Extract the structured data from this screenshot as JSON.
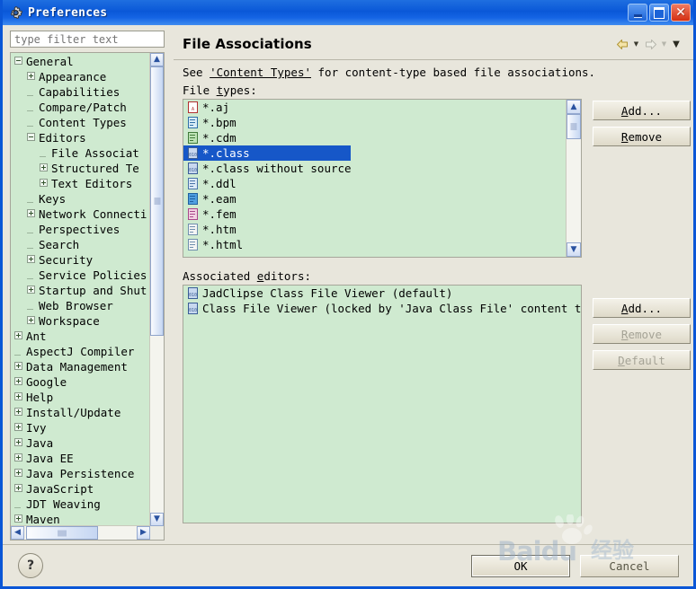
{
  "window": {
    "title": "Preferences",
    "icon": "gear-icon",
    "buttons": {
      "minimize": "minimize-icon",
      "maximize": "maximize-icon",
      "close": "close-icon"
    }
  },
  "filter": {
    "placeholder": "type filter text",
    "value": ""
  },
  "tree": {
    "items": [
      {
        "label": "General",
        "indent": 0,
        "toggle": "minus",
        "selected": false
      },
      {
        "label": "Appearance",
        "indent": 1,
        "toggle": "plus",
        "selected": false
      },
      {
        "label": "Capabilities",
        "indent": 1,
        "toggle": "none",
        "selected": false
      },
      {
        "label": "Compare/Patch",
        "indent": 1,
        "toggle": "none",
        "selected": false
      },
      {
        "label": "Content Types",
        "indent": 1,
        "toggle": "none",
        "selected": false
      },
      {
        "label": "Editors",
        "indent": 1,
        "toggle": "minus",
        "selected": false
      },
      {
        "label": "File Associat",
        "indent": 2,
        "toggle": "none",
        "selected": false
      },
      {
        "label": "Structured Te",
        "indent": 2,
        "toggle": "plus",
        "selected": false
      },
      {
        "label": "Text Editors",
        "indent": 2,
        "toggle": "plus",
        "selected": false
      },
      {
        "label": "Keys",
        "indent": 1,
        "toggle": "none",
        "selected": false
      },
      {
        "label": "Network Connecti",
        "indent": 1,
        "toggle": "plus",
        "selected": false
      },
      {
        "label": "Perspectives",
        "indent": 1,
        "toggle": "none",
        "selected": false
      },
      {
        "label": "Search",
        "indent": 1,
        "toggle": "none",
        "selected": false
      },
      {
        "label": "Security",
        "indent": 1,
        "toggle": "plus",
        "selected": false
      },
      {
        "label": "Service Policies",
        "indent": 1,
        "toggle": "none",
        "selected": false
      },
      {
        "label": "Startup and Shut",
        "indent": 1,
        "toggle": "plus",
        "selected": false
      },
      {
        "label": "Web Browser",
        "indent": 1,
        "toggle": "none",
        "selected": false
      },
      {
        "label": "Workspace",
        "indent": 1,
        "toggle": "plus",
        "selected": false
      },
      {
        "label": "Ant",
        "indent": 0,
        "toggle": "plus",
        "selected": false
      },
      {
        "label": "AspectJ Compiler",
        "indent": 0,
        "toggle": "none",
        "selected": false
      },
      {
        "label": "Data Management",
        "indent": 0,
        "toggle": "plus",
        "selected": false
      },
      {
        "label": "Google",
        "indent": 0,
        "toggle": "plus",
        "selected": false
      },
      {
        "label": "Help",
        "indent": 0,
        "toggle": "plus",
        "selected": false
      },
      {
        "label": "Install/Update",
        "indent": 0,
        "toggle": "plus",
        "selected": false
      },
      {
        "label": "Ivy",
        "indent": 0,
        "toggle": "plus",
        "selected": false
      },
      {
        "label": "Java",
        "indent": 0,
        "toggle": "plus",
        "selected": false
      },
      {
        "label": "Java EE",
        "indent": 0,
        "toggle": "plus",
        "selected": false
      },
      {
        "label": "Java Persistence",
        "indent": 0,
        "toggle": "plus",
        "selected": false
      },
      {
        "label": "JavaScript",
        "indent": 0,
        "toggle": "plus",
        "selected": false
      },
      {
        "label": "JDT Weaving",
        "indent": 0,
        "toggle": "none",
        "selected": false
      },
      {
        "label": "Maven",
        "indent": 0,
        "toggle": "plus",
        "selected": false
      }
    ]
  },
  "page": {
    "title": "File Associations",
    "nav": {
      "back_icon": "back-arrow-icon",
      "back_menu_icon": "chevron-down-icon",
      "forward_icon": "forward-arrow-icon",
      "forward_menu_icon": "chevron-down-icon",
      "menu_icon": "chevron-down-icon"
    },
    "description_prefix": "See ",
    "description_link": "'Content Types'",
    "description_suffix": " for content-type based file associations.",
    "file_types_label_pre": "File ",
    "file_types_label_mnemonic": "t",
    "file_types_label_post": "ypes:",
    "associated_editors_label_pre": "Associated ",
    "associated_editors_label_mnemonic": "e",
    "associated_editors_label_post": "ditors:"
  },
  "file_types": {
    "rows": [
      {
        "label": "*.aj",
        "icon": "aspectj-file-icon",
        "selected": false
      },
      {
        "label": "*.bpm",
        "icon": "bpm-file-icon",
        "selected": false
      },
      {
        "label": "*.cdm",
        "icon": "cdm-file-icon",
        "selected": false
      },
      {
        "label": "*.class",
        "icon": "class-file-icon",
        "selected": true
      },
      {
        "label": "*.class without source",
        "icon": "class-file-icon",
        "selected": false
      },
      {
        "label": "*.ddl",
        "icon": "ddl-file-icon",
        "selected": false
      },
      {
        "label": "*.eam",
        "icon": "eam-file-icon",
        "selected": false
      },
      {
        "label": "*.fem",
        "icon": "fem-file-icon",
        "selected": false
      },
      {
        "label": "*.htm",
        "icon": "html-file-icon",
        "selected": false
      },
      {
        "label": "*.html",
        "icon": "html-file-icon",
        "selected": false
      }
    ],
    "buttons": [
      {
        "label_pre": "",
        "mnemonic": "A",
        "label_post": "dd...",
        "enabled": true,
        "name": "file-types-add-button"
      },
      {
        "label_pre": "",
        "mnemonic": "R",
        "label_post": "emove",
        "enabled": true,
        "name": "file-types-remove-button"
      }
    ]
  },
  "associated_editors": {
    "rows": [
      {
        "label": "JadClipse Class File Viewer (default)",
        "icon": "class-file-icon"
      },
      {
        "label": "Class File Viewer (locked by 'Java Class File' content type)",
        "icon": "class-file-icon"
      }
    ],
    "buttons": [
      {
        "label_pre": "",
        "mnemonic": "A",
        "label_post": "dd...",
        "enabled": true,
        "name": "editors-add-button"
      },
      {
        "label_pre": "",
        "mnemonic": "R",
        "label_post": "emove",
        "enabled": false,
        "name": "editors-remove-button"
      },
      {
        "label_pre": "",
        "mnemonic": "D",
        "label_post": "efault",
        "enabled": false,
        "name": "editors-default-button"
      }
    ]
  },
  "footer": {
    "help_label": "?",
    "ok_label": "OK",
    "cancel_label": "Cancel"
  },
  "watermark": {
    "text": "Baidu",
    "text_cn": "经验"
  },
  "colors": {
    "title_bar_blue": "#0a58d8",
    "dialog_background": "#e8e6dc",
    "list_background": "#cfead0",
    "selection_blue": "#1657c8",
    "close_button_red": "#d42f12"
  }
}
